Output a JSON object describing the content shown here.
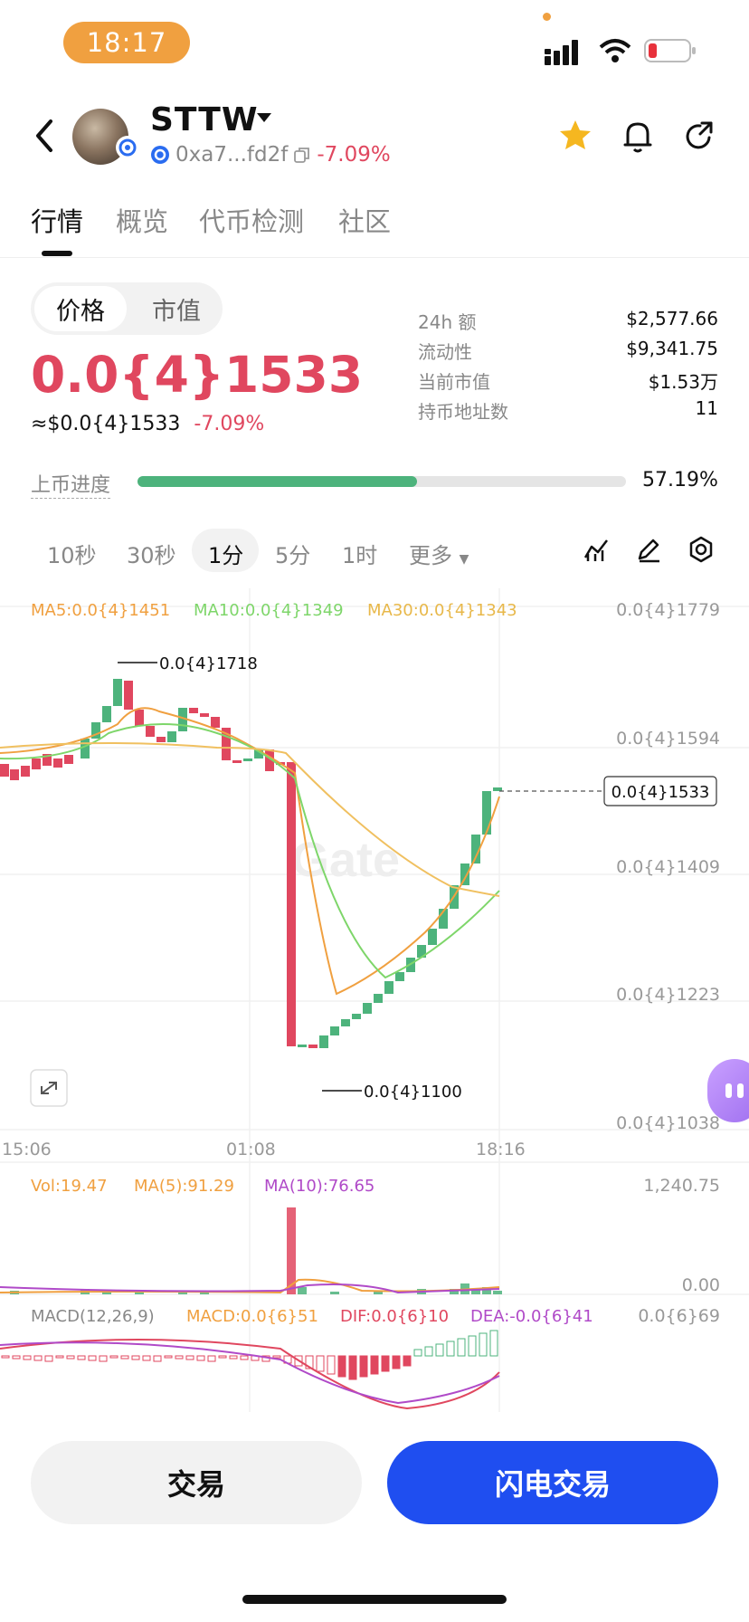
{
  "status_bar": {
    "time": "18:17"
  },
  "header": {
    "token": "STTW",
    "address": "0xa7...fd2f",
    "change": "-7.09%"
  },
  "tabs": [
    "行情",
    "概览",
    "代币检测",
    "社区"
  ],
  "price_toggle": [
    "价格",
    "市值"
  ],
  "price": {
    "main": "0.0{4}1533",
    "usd": "≈$0.0{4}1533",
    "change": "-7.09%"
  },
  "stats": [
    {
      "label": "24h  额",
      "value": "$2,577.66"
    },
    {
      "label": "流动性",
      "value": "$9,341.75"
    },
    {
      "label": "当前市值",
      "value": "$1.53万"
    },
    {
      "label": "持币地址数",
      "value": "11"
    }
  ],
  "listing_progress": {
    "label": "上币进度",
    "value": "57.19%",
    "fraction": 0.5719
  },
  "intervals": [
    "10秒",
    "30秒",
    "1分",
    "5分",
    "1时",
    "更多"
  ],
  "selected_interval": "1分",
  "chart": {
    "ma_legend": {
      "ma5": "MA5:0.0{4}1451",
      "ma10": "MA10:0.0{4}1349",
      "ma30": "MA30:0.0{4}1343"
    },
    "y_ticks": [
      "0.0{4}1779",
      "0.0{4}1594",
      "0.0{4}1409",
      "0.0{4}1223",
      "0.0{4}1038"
    ],
    "x_ticks": [
      "15:06",
      "01:08",
      "18:16"
    ],
    "high_label": "0.0{4}1718",
    "low_label": "0.0{4}1100",
    "last_price_label": "0.0{4}1533",
    "watermark": "Gate",
    "colors": {
      "up": "#4db37c",
      "down": "#e0475f",
      "ma5": "#f0a040",
      "ma10": "#7ed66a",
      "ma30": "#f0c060"
    }
  },
  "volume": {
    "vol": "Vol:19.47",
    "ma5": "MA(5):91.29",
    "ma10": "MA(10):76.65",
    "y_top": "1,240.75",
    "y_bottom": "0.00"
  },
  "macd": {
    "title": "MACD(12,26,9)",
    "macd": "MACD:0.0{6}51",
    "dif": "DIF:0.0{6}10",
    "dea": "DEA:-0.0{6}41",
    "y_top": "0.0{6}69"
  },
  "buttons": {
    "trade": "交易",
    "flash_trade": "闪电交易"
  }
}
